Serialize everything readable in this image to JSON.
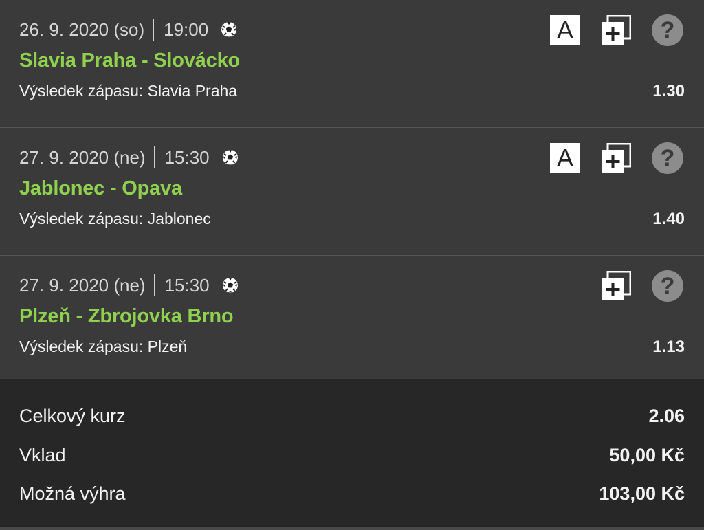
{
  "bets": [
    {
      "date": "26. 9. 2020 (so)",
      "time": "19:00",
      "sport_icon": "soccer-ball-icon",
      "match": "Slavia Praha - Slovácko",
      "market_label": "Výsledek zápasu:",
      "pick": "Slavia Praha",
      "odds": "1.30",
      "icons": {
        "a": "A",
        "copy": "copy-icon",
        "help": "?"
      }
    },
    {
      "date": "27. 9. 2020 (ne)",
      "time": "15:30",
      "sport_icon": "soccer-ball-icon",
      "match": "Jablonec - Opava",
      "market_label": "Výsledek zápasu:",
      "pick": "Jablonec",
      "odds": "1.40",
      "icons": {
        "a": "A",
        "copy": "copy-icon",
        "help": "?"
      }
    },
    {
      "date": "27. 9. 2020 (ne)",
      "time": "15:30",
      "sport_icon": "soccer-ball-icon",
      "match": "Plzeň - Zbrojovka Brno",
      "market_label": "Výsledek zápasu:",
      "pick": "Plzeň",
      "odds": "1.13",
      "icons": {
        "copy": "copy-icon",
        "help": "?"
      }
    }
  ],
  "summary": {
    "total_odds_label": "Celkový kurz",
    "total_odds": "2.06",
    "stake_label": "Vklad",
    "stake": "50,00 Kč",
    "win_label": "Možná výhra",
    "win": "103,00 Kč"
  },
  "colors": {
    "background": "#3b3a3a",
    "summary_background": "#282727",
    "match_green": "#8fd14f",
    "text": "#f2f2f2",
    "help_icon": "#8c8c8c"
  }
}
